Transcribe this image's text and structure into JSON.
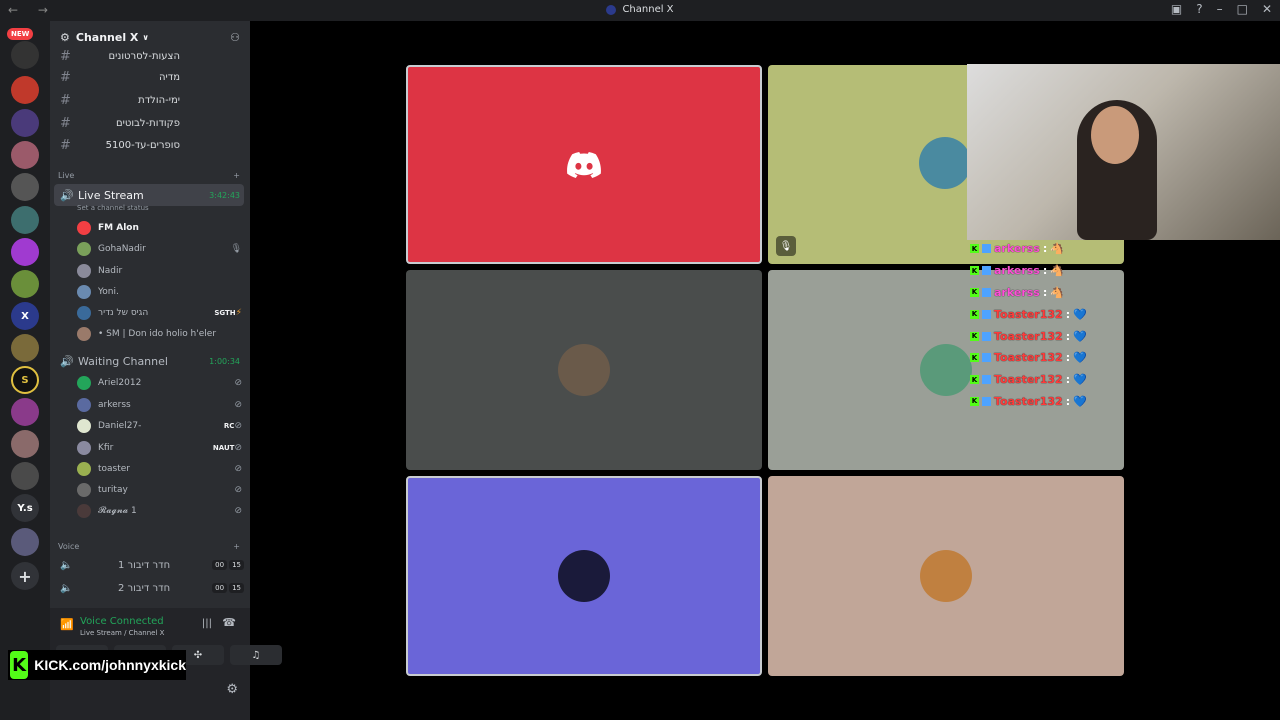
{
  "window": {
    "title": "Channel X"
  },
  "servers": {
    "new_label": "NEW",
    "ys_label": "Y.s"
  },
  "guild": {
    "name": "Channel X"
  },
  "text_channels": [
    {
      "name": "הצעות-לסרטונים"
    },
    {
      "name": "מדיה"
    },
    {
      "name": "ימי-הולדת"
    },
    {
      "name": "פקודות-לבוטים"
    },
    {
      "name": "סופרים-עד-5100"
    }
  ],
  "categories": {
    "live": "Live",
    "voice": "Voice"
  },
  "live_stream": {
    "name": "Live Stream",
    "timer": "3:42:43",
    "status": "Set a channel status"
  },
  "live_members": [
    "FM Alon",
    "GohaNadir",
    "Nadir",
    "Yoni.",
    "הגיס של נדיר",
    "• SM | Don ido holio h'eler"
  ],
  "live_badges": {
    "sgth": "SGTH"
  },
  "waiting_channel": {
    "name": "Waiting Channel",
    "timer": "1:00:34"
  },
  "waiting_members": [
    "Ariel2012",
    "arkerss",
    "Daniel27-",
    "Kfir",
    "toaster",
    "turitay",
    "𝓡𝓪𝓰𝓷𝓪 1"
  ],
  "waiting_badges": {
    "rc": "RC",
    "naut": "NAUT"
  },
  "voice_channels": [
    {
      "name": "חדר דיבור 1",
      "count_a": "00",
      "count_b": "15"
    },
    {
      "name": "חדר דיבור 2",
      "count_a": "00",
      "count_b": "15"
    }
  ],
  "voice_connected": {
    "title": "Voice Connected",
    "sub": "Live Stream / Channel X"
  },
  "kick_overlay": {
    "url": "KICK.com/johnnyxkick",
    "logo": "K"
  },
  "chat_overlay": [
    {
      "user": "arkerss",
      "color": "#ff4fd8",
      "emote": "🐴"
    },
    {
      "user": "arkerss",
      "color": "#ff4fd8",
      "emote": "🐴"
    },
    {
      "user": "arkerss",
      "color": "#ff4fd8",
      "emote": "🐴"
    },
    {
      "user": "Toaster132",
      "color": "#ff3b3b",
      "emote": "💙"
    },
    {
      "user": "Toaster132",
      "color": "#ff3b3b",
      "emote": "💙"
    },
    {
      "user": "Toaster132",
      "color": "#ff3b3b",
      "emote": "💙"
    },
    {
      "user": "Toaster132",
      "color": "#ff3b3b",
      "emote": "💙"
    },
    {
      "user": "Toaster132",
      "color": "#ff3b3b",
      "emote": "💙"
    }
  ],
  "colors": {
    "discord_red": "#dd3444",
    "olive": "#b5bd76",
    "slate": "#4a4d4c",
    "sage": "#9a9f97",
    "blurple": "#6a65d8",
    "tan": "#c1a698",
    "green": "#23a55a"
  }
}
